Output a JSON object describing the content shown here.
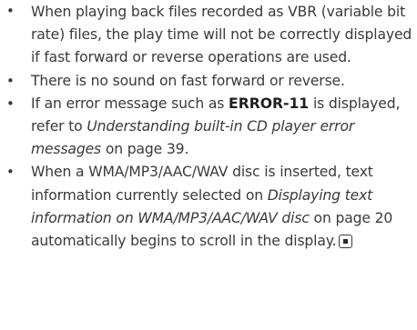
{
  "bullets": [
    {
      "text": "When playing back files recorded as VBR (variable bit rate) files, the play time will not be correctly displayed if fast forward or reverse operations are used."
    },
    {
      "text": "There is no sound on fast forward or reverse."
    },
    {
      "part1": "If an error message such as ",
      "bold": "ERROR-11",
      "part2": " is dis­played, refer to ",
      "ref": "Understanding built-in CD player error messages",
      "part3": " on page 39."
    },
    {
      "part1": "When a WMA/MP3/AAC/WAV disc is inserted, text information currently selected on ",
      "ref": "Display­ing text information on WMA/MP3/AAC/WAV disc",
      "part2": " on page 20 automatically begins to scroll in the display."
    }
  ],
  "bullet_symbol": "•",
  "end_icon": "end-of-section-icon"
}
